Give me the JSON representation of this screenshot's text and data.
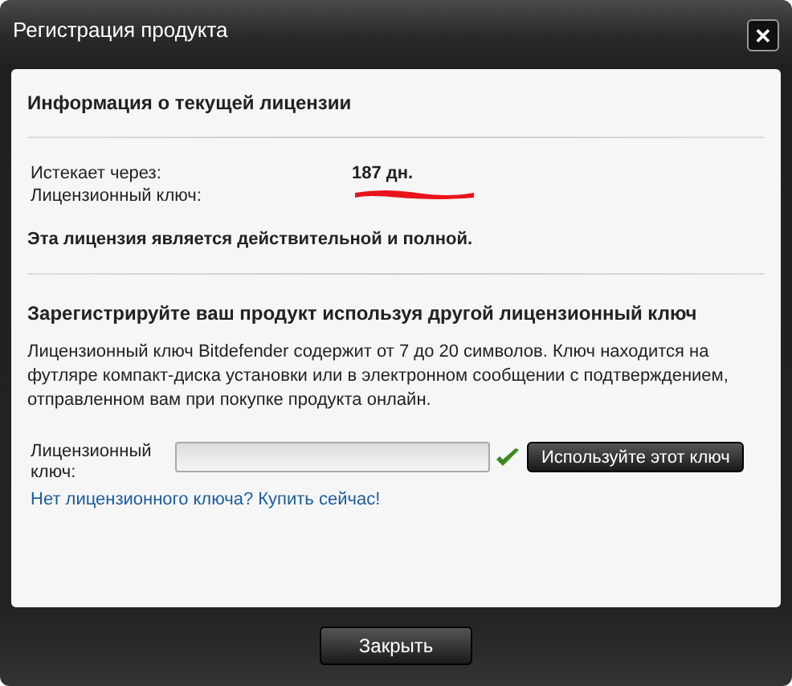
{
  "window": {
    "title": "Регистрация продукта",
    "close_glyph": "✕"
  },
  "current_license": {
    "heading": "Информация о текущей лицензии",
    "rows": [
      {
        "label": "Истекает через:",
        "value": "187 дн.",
        "kind": "text"
      },
      {
        "label": "Лицензионный ключ:",
        "kind": "redacted"
      }
    ],
    "status": "Эта лицензия является действительной и полной."
  },
  "register": {
    "heading": "Зарегистрируйте ваш продукт используя другой лицензионный ключ",
    "description": "Лицензионный ключ Bitdefender содержит от 7 до 20 символов. Ключ находится на футляре компакт-диска установки или в электронном сообщении с подтверждением, отправленном вам при покупке продукта онлайн.",
    "field_label": "Лицензионный ключ:",
    "valid": true,
    "button": "Используйте этот ключ",
    "link": "Нет лицензионного ключа? Купить сейчас!"
  },
  "footer": {
    "button": "Закрыть"
  }
}
